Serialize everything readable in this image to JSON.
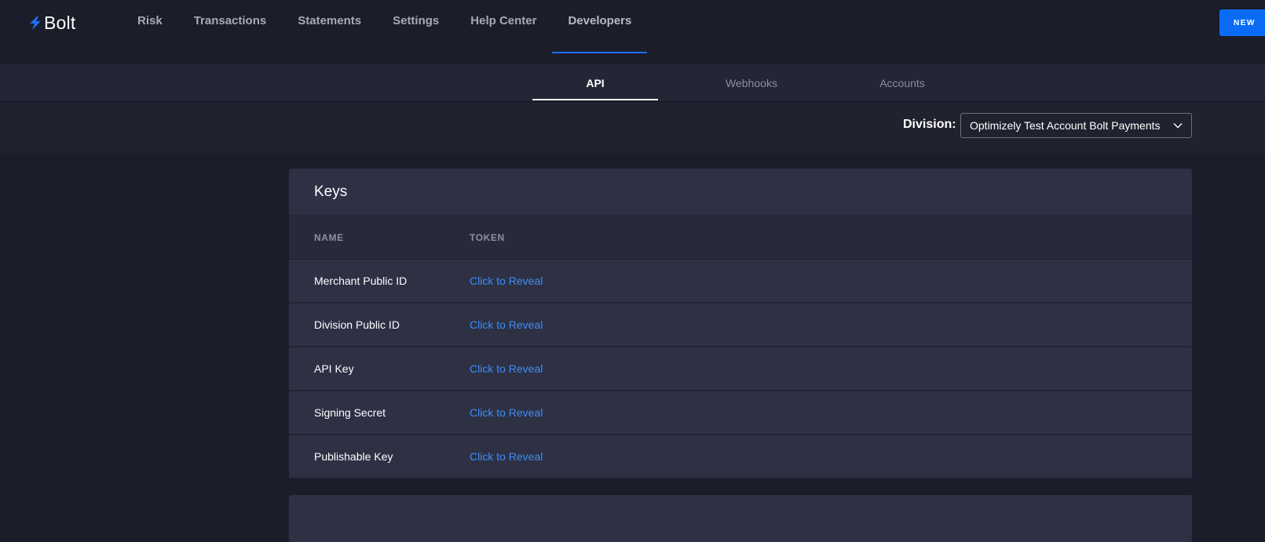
{
  "brand": {
    "name": "Bolt",
    "accent": "#1e6ef5"
  },
  "nav": {
    "items": [
      {
        "label": "Risk"
      },
      {
        "label": "Transactions"
      },
      {
        "label": "Statements"
      },
      {
        "label": "Settings"
      },
      {
        "label": "Help Center"
      },
      {
        "label": "Developers",
        "active": true
      }
    ]
  },
  "header_button": {
    "label": "NEW"
  },
  "subnav": {
    "tabs": [
      {
        "label": "API",
        "active": true
      },
      {
        "label": "Webhooks"
      },
      {
        "label": "Accounts"
      }
    ]
  },
  "division": {
    "label": "Division:",
    "selected": "Optimizely Test Account Bolt Payments",
    "icon": "chevron-down-icon"
  },
  "keys_card": {
    "title": "Keys",
    "columns": [
      "NAME",
      "TOKEN"
    ],
    "rows": [
      {
        "name": "Merchant Public ID",
        "token": "Click to Reveal"
      },
      {
        "name": "Division Public ID",
        "token": "Click to Reveal"
      },
      {
        "name": "API Key",
        "token": "Click to Reveal"
      },
      {
        "name": "Signing Secret",
        "token": "Click to Reveal"
      },
      {
        "name": "Publishable Key",
        "token": "Click to Reveal"
      }
    ]
  },
  "colors": {
    "background": "#1c1d2a",
    "card": "#2e3044",
    "link": "#3d8ef7",
    "primary_button": "#0a6cf5"
  }
}
